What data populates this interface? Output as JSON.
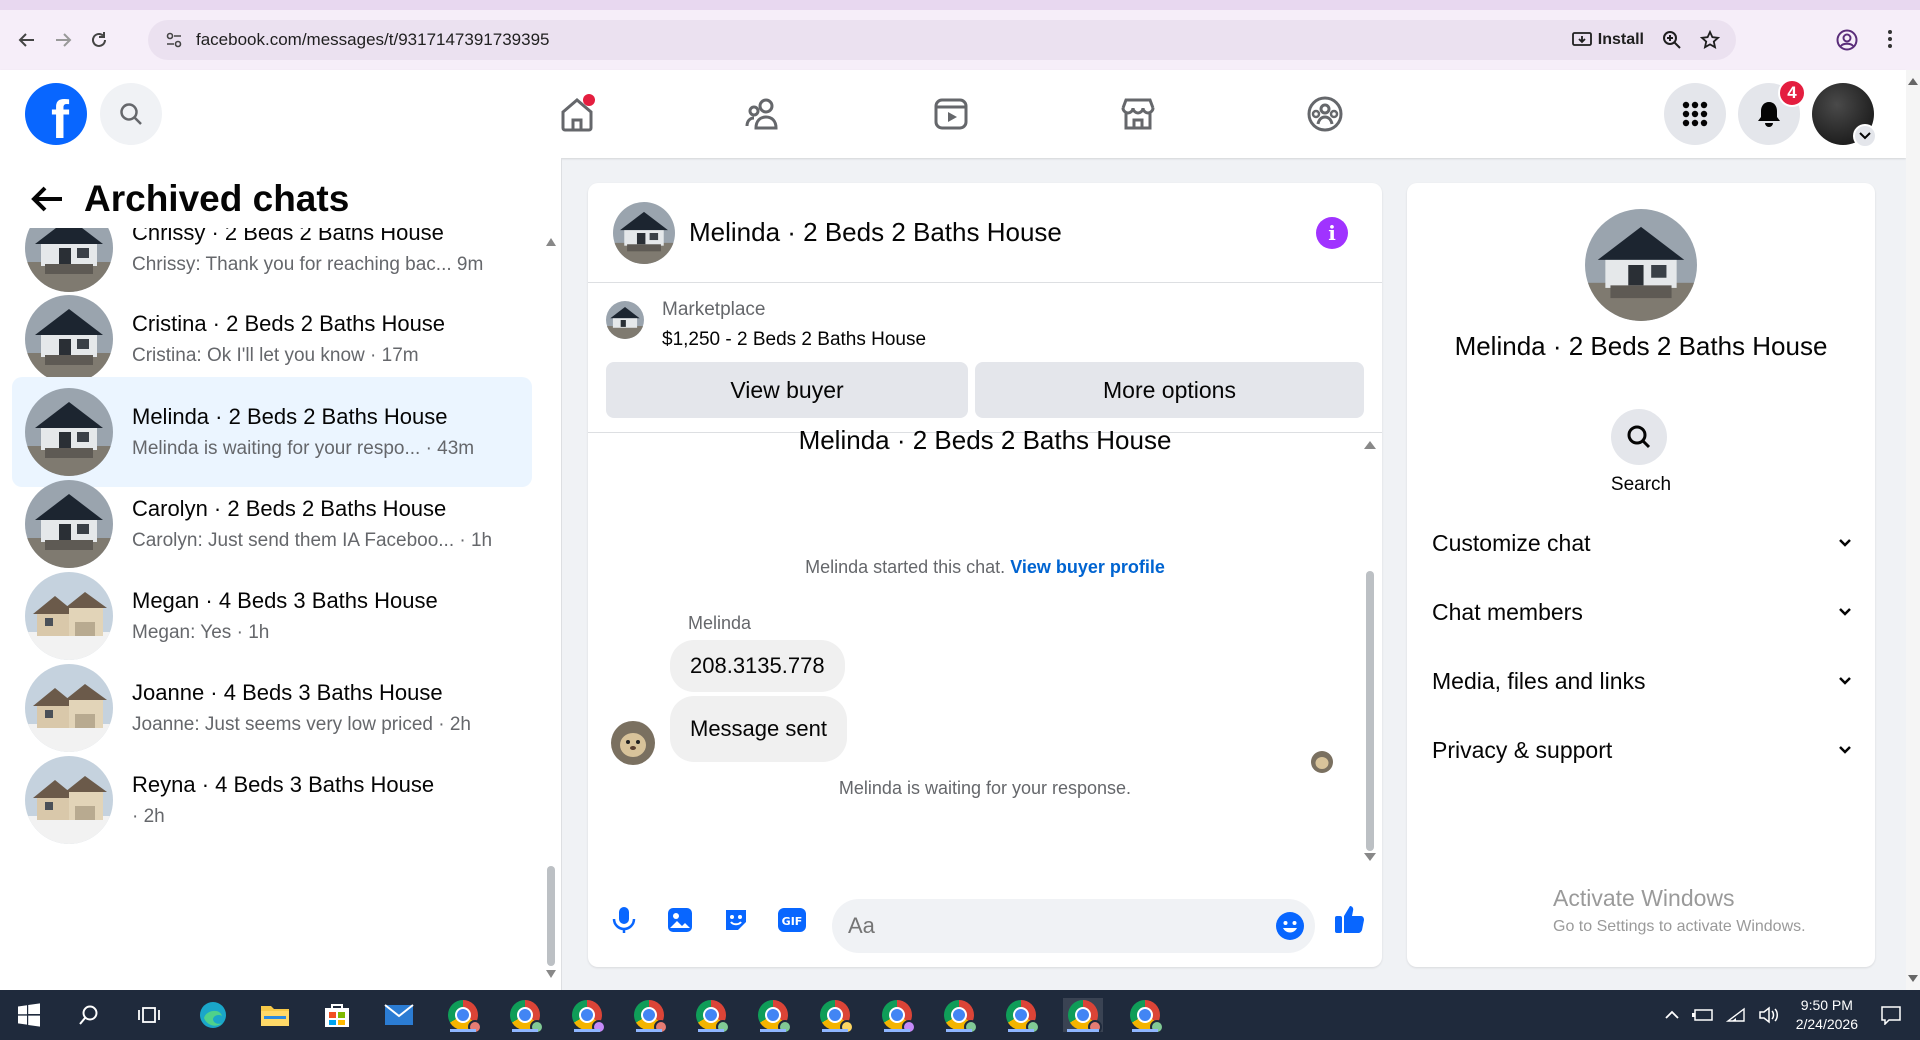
{
  "browser": {
    "url": "facebook.com/messages/t/9317147391739395",
    "install_label": "Install"
  },
  "header": {
    "notification_count": "4"
  },
  "sidebar": {
    "title": "Archived chats",
    "chats": [
      {
        "name": "Chrissy · 2 Beds 2 Baths House",
        "preview": "Chrissy: Thank you for reaching bac... 9m"
      },
      {
        "name": "Cristina · 2 Beds 2 Baths House",
        "preview": "Cristina: Ok I'll let you know · 17m"
      },
      {
        "name": "Melinda · 2 Beds 2 Baths House",
        "preview": "Melinda is waiting for your respo...  · 43m"
      },
      {
        "name": "Carolyn · 2 Beds 2 Baths House",
        "preview": "Carolyn: Just send them IA Faceboo... · 1h"
      },
      {
        "name": "Megan · 4 Beds 3 Baths House",
        "preview": "Megan: Yes · 1h"
      },
      {
        "name": "Joanne · 4 Beds 3 Baths House",
        "preview": "Joanne: Just seems very low priced · 2h"
      },
      {
        "name": "Reyna · 4 Beds 3 Baths House",
        "preview": " · 2h"
      }
    ]
  },
  "chat": {
    "title": "Melinda · 2 Beds 2 Baths House",
    "marketplace_label": "Marketplace",
    "listing": "$1,250 - 2 Beds 2 Baths House",
    "view_buyer": "View buyer",
    "more_options": "More options",
    "started_text": "Melinda started this chat.",
    "view_buyer_profile": "View buyer profile",
    "sender": "Melinda",
    "messages": [
      "208.3135.778",
      "Message sent"
    ],
    "waiting_text": "Melinda is waiting for your response.",
    "composer_placeholder": "Aa"
  },
  "info": {
    "name": "Melinda · 2 Beds 2 Baths House",
    "search_label": "Search",
    "sections": [
      "Customize chat",
      "Chat members",
      "Media, files and links",
      "Privacy & support"
    ]
  },
  "watermark": {
    "line1": "Activate Windows",
    "line2": "Go to Settings to activate Windows."
  },
  "taskbar": {
    "time": "9:50 PM",
    "date": "2/24/2026"
  }
}
